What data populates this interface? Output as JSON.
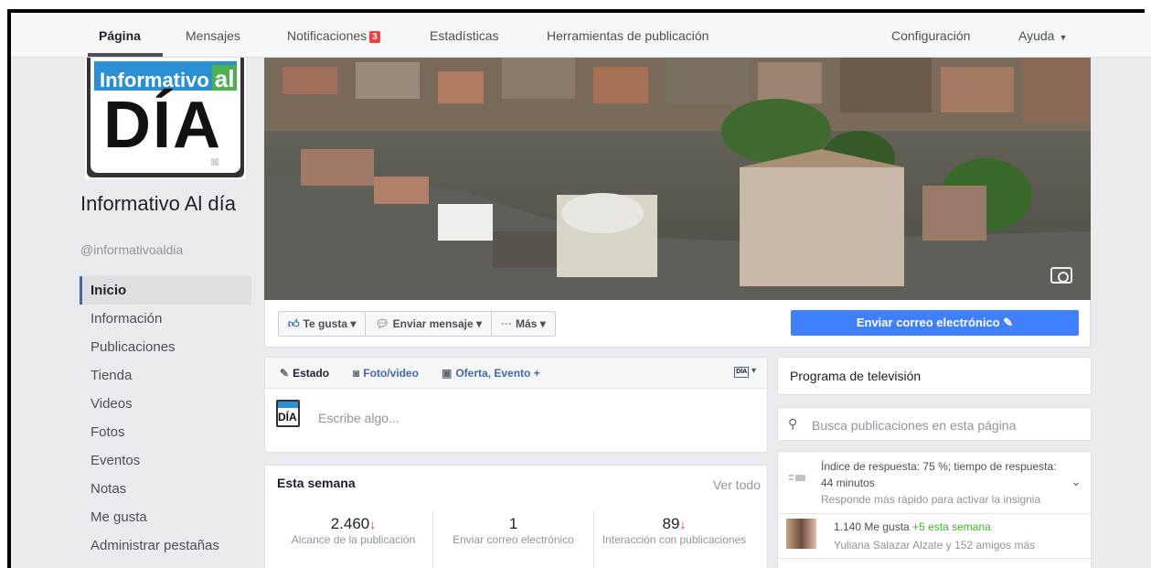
{
  "nav": {
    "items": [
      "Página",
      "Mensajes",
      "Notificaciones",
      "Estadísticas",
      "Herramientas de publicación"
    ],
    "notif_count": "3",
    "settings": "Configuración",
    "help": "Ayuda"
  },
  "page": {
    "logo_top": "Informativo",
    "logo_al": "al",
    "logo_main": "DÍA",
    "name": "Informativo Al día",
    "handle": "@informativoaldia"
  },
  "sidebar": {
    "items": [
      "Inicio",
      "Información",
      "Publicaciones",
      "Tienda",
      "Videos",
      "Fotos",
      "Eventos",
      "Notas",
      "Me gusta",
      "Administrar pestañas"
    ]
  },
  "actions": {
    "like": "Te gusta",
    "message": "Enviar mensaje",
    "more": "Más",
    "email": "Enviar correo electrónico"
  },
  "composer": {
    "tab_status": "Estado",
    "tab_photo": "Foto/video",
    "tab_offer": "Oferta, Evento +",
    "placeholder": "Escribe algo..."
  },
  "week": {
    "title": "Esta semana",
    "see_all": "Ver todo",
    "stats": [
      {
        "value": "2.460",
        "label": "Alcance de la publicación",
        "down": true
      },
      {
        "value": "1",
        "label": "Enviar correo electrónico",
        "down": false
      },
      {
        "value": "89",
        "label": "Interacción con publicaciones",
        "down": true
      }
    ]
  },
  "right": {
    "category": "Programa de televisión",
    "search_placeholder": "Busca publicaciones en esta página",
    "response_line": "Índice de respuesta: 75 %; tiempo de respuesta: 44 minutos",
    "response_hint": "Responde más rápido para activar la insignia",
    "likes_count": "1.140 Me gusta",
    "likes_week": "+5 esta semana",
    "likes_friends": "Yuliana Salazar Alzate y 152 amigos más"
  },
  "colors": {
    "fb_blue": "#4267b2",
    "email_btn": "#4080ff",
    "badge_red": "#fa3e3e",
    "green": "#42b72a"
  }
}
